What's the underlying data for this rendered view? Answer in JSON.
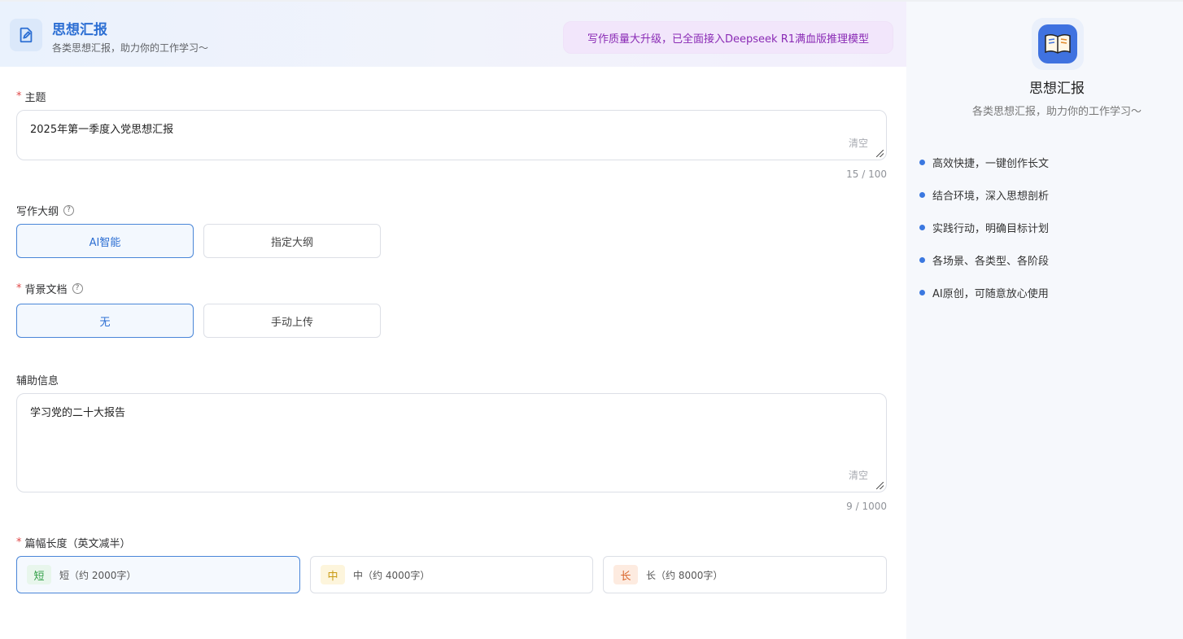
{
  "header": {
    "app_title": "思想汇报",
    "app_subtitle": "各类思想汇报，助力你的工作学习～",
    "promo_text": "写作质量大升级，已全面接入Deepseek R1满血版推理模型"
  },
  "form": {
    "topic": {
      "label": "主题",
      "required": true,
      "value": "2025年第一季度入党思想汇报",
      "clear_label": "清空",
      "counter": "15 / 100"
    },
    "outline": {
      "label": "写作大纲",
      "help_icon": "question-circle-icon",
      "options": [
        "AI智能",
        "指定大纲"
      ],
      "selected": "AI智能"
    },
    "background_doc": {
      "label": "背景文档",
      "required": true,
      "help_icon": "question-circle-icon",
      "options": [
        "无",
        "手动上传"
      ],
      "selected": "无"
    },
    "aux_info": {
      "label": "辅助信息",
      "value": "学习党的二十大报告",
      "clear_label": "清空",
      "counter": "9 / 1000"
    },
    "length": {
      "label": "篇幅长度（英文减半）",
      "required": true,
      "options": [
        {
          "tag": "短",
          "text": "短（约 2000字）",
          "tag_color": "#2f9e44",
          "tag_bg": "#e8f6ec"
        },
        {
          "tag": "中",
          "text": "中（约 4000字）",
          "tag_color": "#c99a12",
          "tag_bg": "#fdf5dc"
        },
        {
          "tag": "长",
          "text": "长（约 8000字）",
          "tag_color": "#d9662c",
          "tag_bg": "#fdebe0"
        }
      ],
      "selected": "短"
    }
  },
  "sidebar": {
    "title": "思想汇报",
    "subtitle": "各类思想汇报，助力你的工作学习～",
    "features": [
      "高效快捷，一键创作长文",
      "结合环境，深入思想剖析",
      "实践行动，明确目标计划",
      "各场景、各类型、各阶段",
      "AI原创，可随意放心使用"
    ]
  },
  "colors": {
    "accent": "#2d6fd3",
    "promo_text": "#8a2bb5",
    "required": "#e04848"
  }
}
